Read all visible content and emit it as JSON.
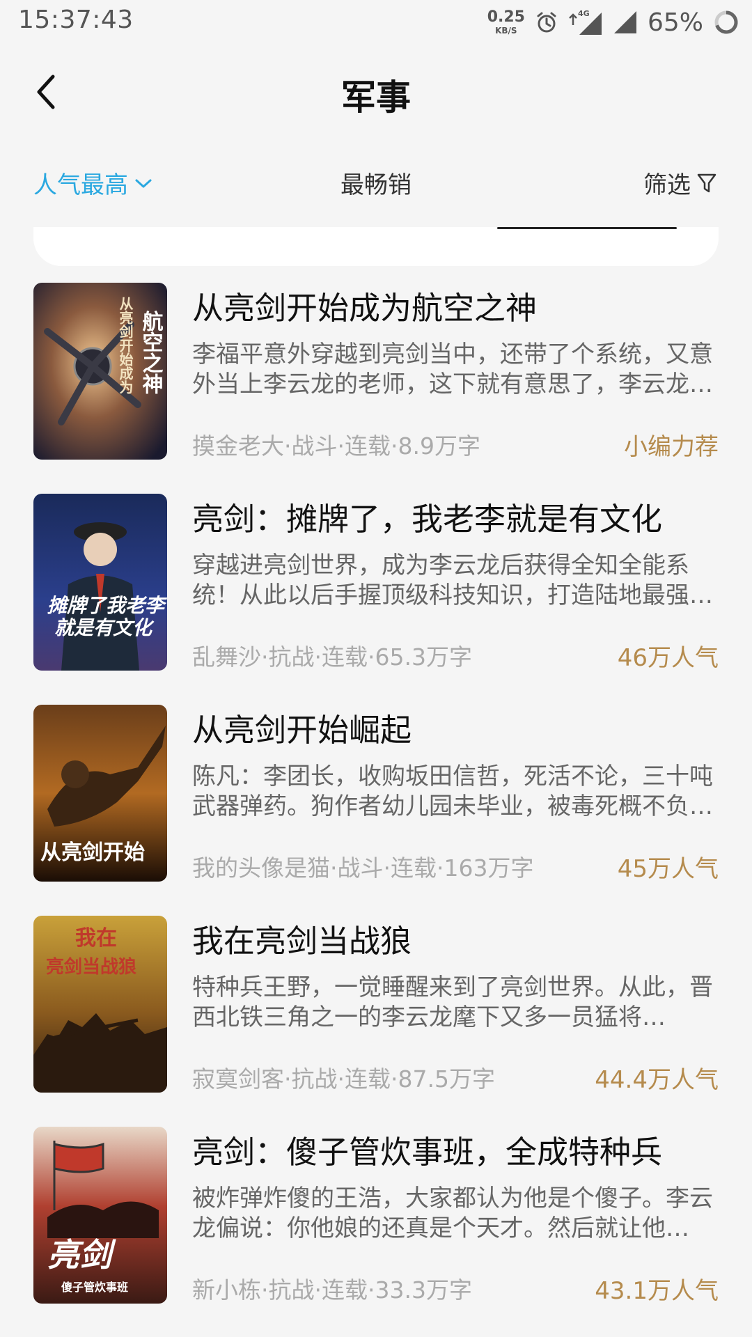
{
  "status_bar": {
    "time": "15:37:43",
    "net_speed": "0.25",
    "net_unit": "KB/S",
    "network": "4G",
    "battery": "65%"
  },
  "header": {
    "title": "军事",
    "back_icon": "chevron-left-icon"
  },
  "tabs": {
    "popular": "人气最高",
    "bestseller": "最畅销",
    "filter": "筛选",
    "active_color": "#2aa8e0"
  },
  "books": [
    {
      "title": "从亮剑开始成为航空之神",
      "desc": "李福平意外穿越到亮剑当中，还带了个系统，又意外当上李云龙的老师，这下就有意思了，李云龙：老师，我想要…",
      "meta": "摸金老大·战斗·连载·8.9万字",
      "badge": "小编力荐",
      "cover_text": "从亮剑开始成为航空之神"
    },
    {
      "title": "亮剑：摊牌了，我老李就是有文化",
      "desc": "穿越进亮剑世界，成为李云龙后获得全知全能系统！从此以后手握顶级科技知识，打造陆地最强部队…",
      "meta": "乱舞沙·抗战·连载·65.3万字",
      "badge": "46万人气",
      "cover_text": "摊牌了我老李就是有文化"
    },
    {
      "title": "从亮剑开始崛起",
      "desc": "陈凡：李团长，收购坂田信哲，死活不论，三十吨武器弹药。狗作者幼儿园未毕业，被毒死概不负责…",
      "meta": "我的头像是猫·战斗·连载·163万字",
      "badge": "45万人气",
      "cover_text": "从亮剑开始"
    },
    {
      "title": "我在亮剑当战狼",
      "desc": "特种兵王野，一觉睡醒来到了亮剑世界。从此，晋西北铁三角之一的李云龙麾下又多一员猛将…",
      "meta": "寂寞剑客·抗战·连载·87.5万字",
      "badge": "44.4万人气",
      "cover_text": "我在亮剑当战狼"
    },
    {
      "title": "亮剑：傻子管炊事班，全成特种兵",
      "desc": "被炸弹炸傻的王浩，大家都认为他是个傻子。李云龙偏说：你他娘的还真是个天才。然后就让他…",
      "meta": "新小栋·抗战·连载·33.3万字",
      "badge": "43.1万人气",
      "cover_text": "亮剑"
    }
  ]
}
